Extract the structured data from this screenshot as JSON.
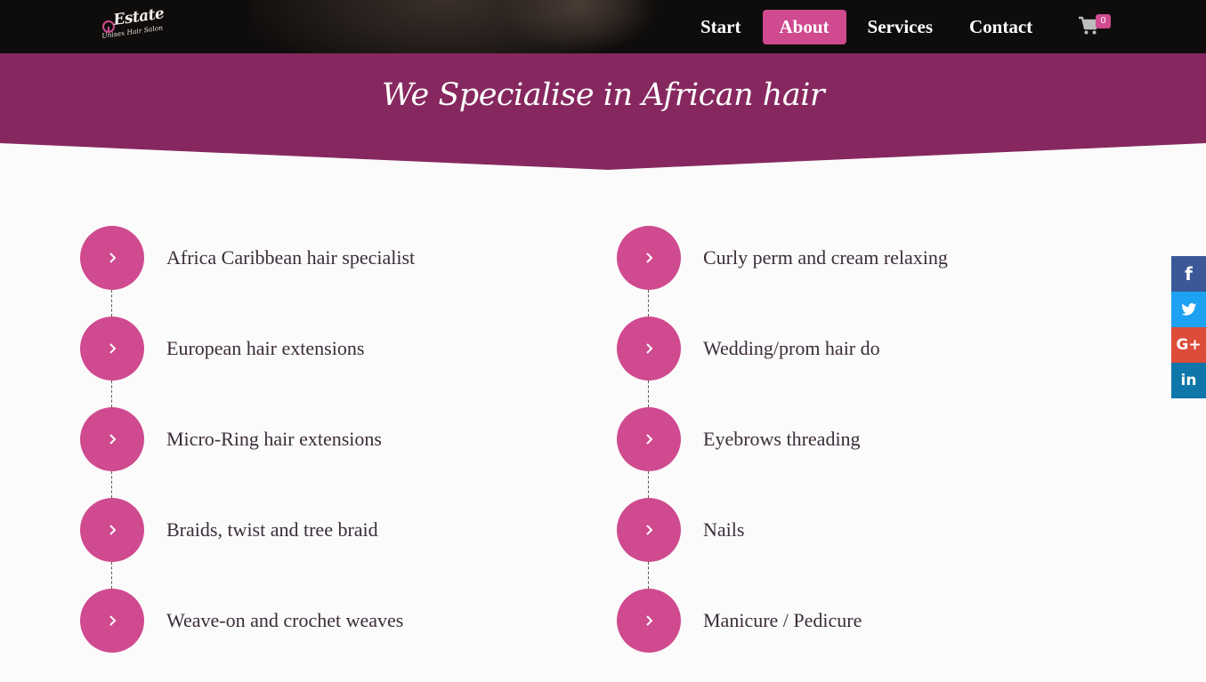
{
  "brand": {
    "name": "Estate",
    "tagline": "Unisex Hair Salon"
  },
  "nav": {
    "items": [
      {
        "label": "Start",
        "active": false
      },
      {
        "label": "About",
        "active": true
      },
      {
        "label": "Services",
        "active": false
      },
      {
        "label": "Contact",
        "active": false
      }
    ],
    "cart_count": "0"
  },
  "banner": {
    "title": "We Specialise in African hair"
  },
  "services": {
    "left": [
      "Africa Caribbean hair specialist",
      "European hair extensions",
      "Micro-Ring hair extensions",
      "Braids, twist and tree braid",
      "Weave-on and crochet weaves"
    ],
    "right": [
      "Curly perm and cream relaxing",
      "Wedding/prom hair do",
      "Eyebrows threading",
      "Nails",
      "Manicure / Pedicure"
    ]
  },
  "social": {
    "facebook": "f",
    "googleplus": "G+",
    "linkedin": "in"
  },
  "colors": {
    "accent": "#cf4a8f",
    "banner": "#86285f",
    "nav_bg": "#0f0d0c",
    "text": "#3a2d38",
    "facebook": "#3b5998",
    "twitter": "#1da1f2",
    "googleplus": "#dd4b39",
    "linkedin": "#0e76a8"
  }
}
